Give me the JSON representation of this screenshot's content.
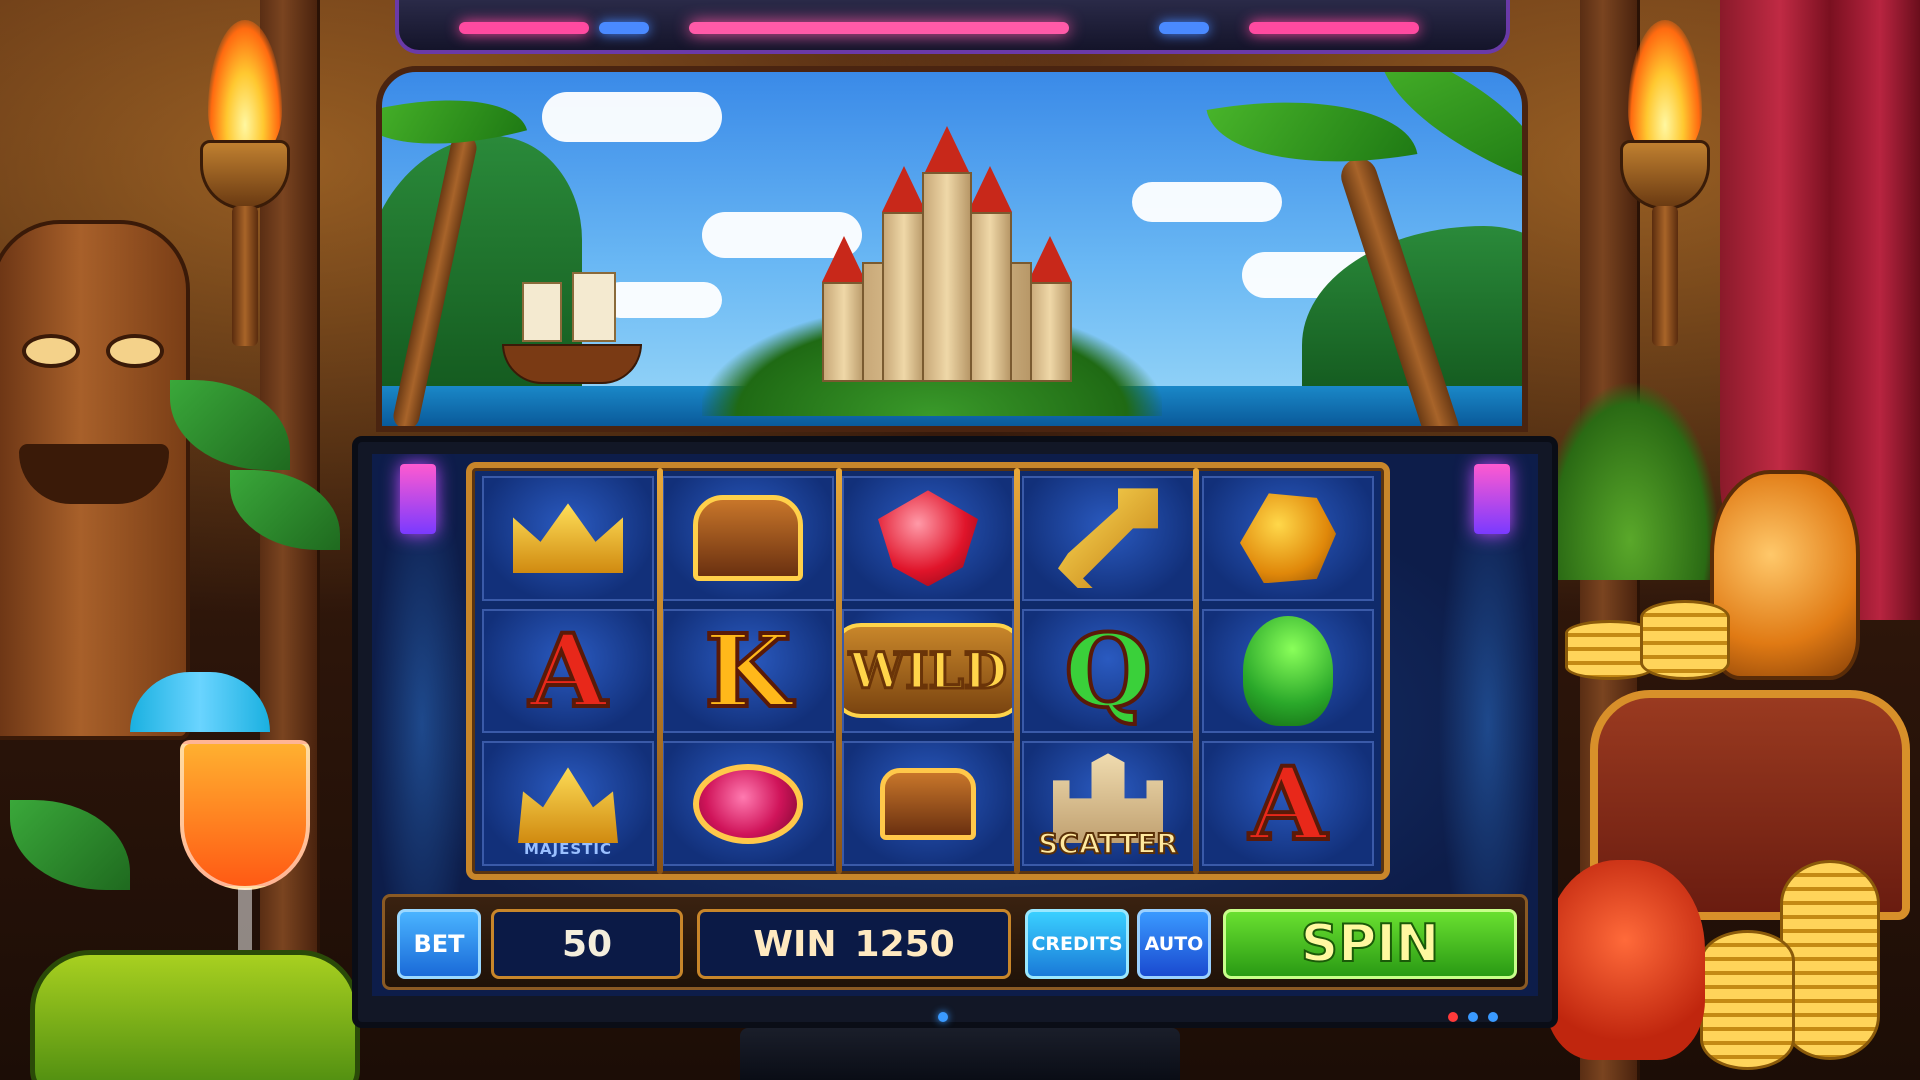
{
  "game": {
    "controls": {
      "bet_label": "BET",
      "bet_value": "50",
      "win_label": "WIN",
      "win_value": "1250",
      "credits_label": "CREDITS",
      "auto_label": "AUTO",
      "spin_label": "SPIN"
    },
    "reels": [
      [
        {
          "symbol": "crown",
          "label": ""
        },
        {
          "symbol": "letter-a",
          "label": "A"
        },
        {
          "symbol": "majestic-crown",
          "label": "MAJESTIC"
        }
      ],
      [
        {
          "symbol": "treasure-chest",
          "label": ""
        },
        {
          "symbol": "letter-k",
          "label": "K"
        },
        {
          "symbol": "ruby-ring",
          "label": ""
        }
      ],
      [
        {
          "symbol": "ruby-gem",
          "label": ""
        },
        {
          "symbol": "wild",
          "label": "WILD"
        },
        {
          "symbol": "small-chest",
          "label": ""
        }
      ],
      [
        {
          "symbol": "golden-key",
          "label": ""
        },
        {
          "symbol": "letter-q",
          "label": "Q"
        },
        {
          "symbol": "castle-scatter",
          "label": "SCATTER"
        }
      ],
      [
        {
          "symbol": "gold-nugget",
          "label": ""
        },
        {
          "symbol": "parrot",
          "label": ""
        },
        {
          "symbol": "letter-a",
          "label": "A"
        }
      ]
    ],
    "colors": {
      "frame_gold": "#c8862a",
      "spin_green": "#3aba1e",
      "bet_blue": "#1a6ad8",
      "letter_a": "#e8281a",
      "letter_k": "#ffb81a",
      "letter_q": "#3ad03a"
    }
  }
}
